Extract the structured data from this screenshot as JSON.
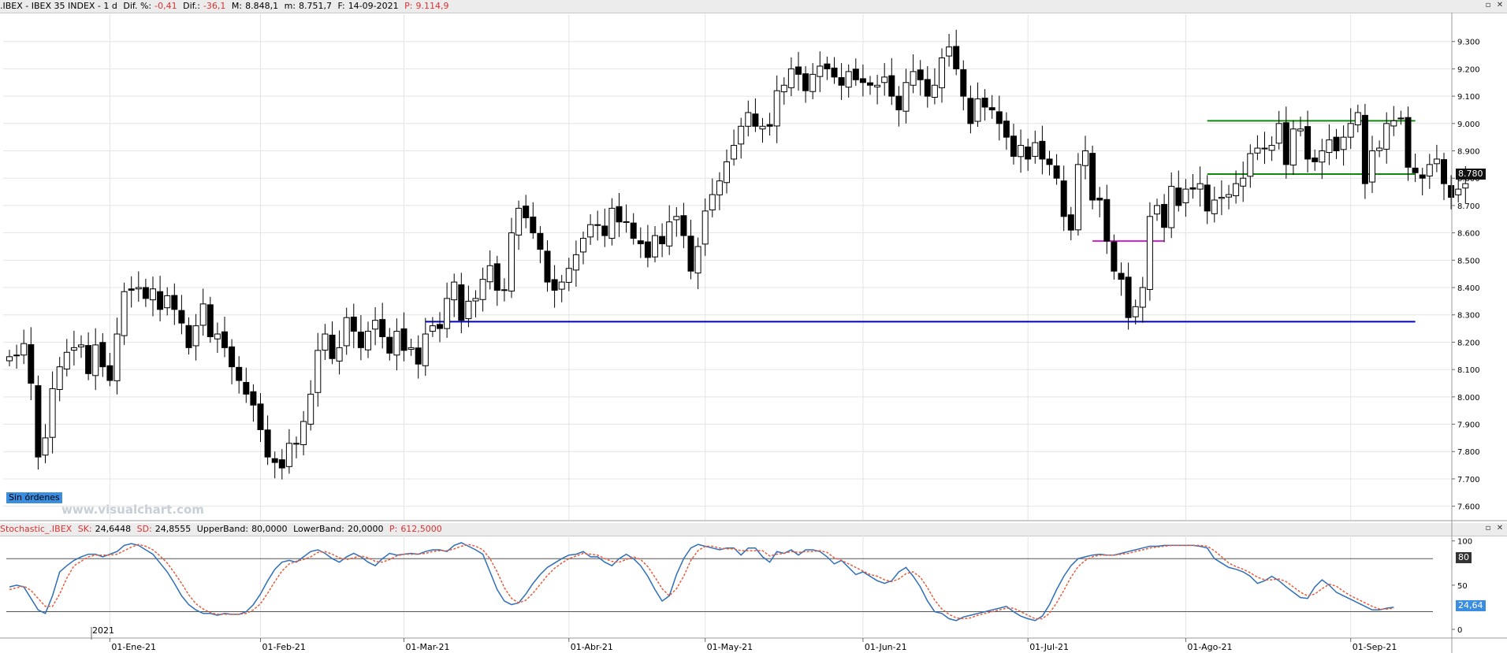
{
  "header": {
    "symbol": ".IBEX - IBEX 35 INDEX - 1 d",
    "dif_pct_label": "Dif. %:",
    "dif_pct": "-0,41",
    "dif_label": "Dif.:",
    "dif": "-36,1",
    "max_label": "M:",
    "max": "8.848,1",
    "min_label": "m:",
    "min": "8.751,7",
    "date_label": "F:",
    "date": "14-09-2021",
    "close_label": "P:",
    "close": "9.114,9"
  },
  "indicator_header": {
    "name": "Stochastic_.IBEX",
    "sk_label": "SK:",
    "sk": "24,6448",
    "sd_label": "SD:",
    "sd": "24,8555",
    "upper_label": "UpperBand:",
    "upper": "80,0000",
    "lower_label": "LowerBand:",
    "lower": "20,0000",
    "p_label": "P:",
    "p": "612,5000"
  },
  "window_controls": {
    "restore": "▫",
    "close": "✕"
  },
  "watermark": "www.visualchart.com",
  "orders_badge": "Sin órdenes",
  "price_badge": "8.780",
  "stoch_badges": {
    "upper": "80",
    "current": "24,64"
  },
  "year_label": "2021",
  "colors": {
    "sk_line": "#2f6fb8",
    "sd_line": "#e85d3a",
    "support": "#0000cc",
    "range": "#118811",
    "gap": "#dd22dd",
    "badge_bg": "#3b8de0",
    "grid": "#e4e4e4"
  },
  "chart_data": [
    {
      "type": "candlestick",
      "ylim": [
        7550,
        9400
      ],
      "yticks": [
        7600,
        7700,
        7800,
        7900,
        8000,
        8100,
        8200,
        8300,
        8400,
        8500,
        8600,
        8700,
        8800,
        8900,
        9000,
        9100,
        9200,
        9300
      ],
      "ytick_labels": [
        "7.600",
        "7.700",
        "7.800",
        "7.900",
        "8.000",
        "8.100",
        "8.200",
        "8.300",
        "8.400",
        "8.500",
        "8.600",
        "8.700",
        "8.800",
        "8.900",
        "9.000",
        "9.100",
        "9.200",
        "9.300"
      ],
      "xtick_labels": [
        "01-Ene-21",
        "01-Feb-21",
        "01-Mar-21",
        "01-Abr-21",
        "01-May-21",
        "01-Jun-21",
        "01-Jul-21",
        "01-Ago-21",
        "01-Sep-21"
      ],
      "xtick_bar_index": [
        14,
        35,
        55,
        78,
        97,
        119,
        142,
        164,
        187
      ],
      "grid": true,
      "horizontal_lines": [
        {
          "name": "support",
          "value": 8275,
          "from_bar": 58,
          "to_bar": 196
        },
        {
          "name": "range-top",
          "value": 9010,
          "from_bar": 167,
          "to_bar": 196
        },
        {
          "name": "range-bottom",
          "value": 8815,
          "from_bar": 167,
          "to_bar": 196
        },
        {
          "name": "gap",
          "value": 8570,
          "from_bar": 151,
          "to_bar": 161
        }
      ],
      "closes": [
        8147,
        8152,
        8195,
        8050,
        7780,
        7850,
        8030,
        8110,
        8163,
        8180,
        8190,
        8085,
        8190,
        8110,
        8060,
        8230,
        8385,
        8390,
        8400,
        8360,
        8395,
        8320,
        8370,
        8320,
        8270,
        8180,
        8260,
        8340,
        8220,
        8230,
        8180,
        8110,
        8060,
        8010,
        7970,
        7880,
        7780,
        7760,
        7740,
        7830,
        7830,
        7910,
        8010,
        8170,
        8230,
        8140,
        8180,
        8290,
        8240,
        8180,
        8240,
        8280,
        8220,
        8160,
        8240,
        8170,
        8180,
        8120,
        8230,
        8260,
        8250,
        8360,
        8420,
        8280,
        8350,
        8360,
        8430,
        8480,
        8390,
        8390,
        8600,
        8690,
        8655,
        8600,
        8540,
        8420,
        8390,
        8420,
        8470,
        8520,
        8580,
        8630,
        8630,
        8590,
        8690,
        8640,
        8640,
        8580,
        8560,
        8510,
        8590,
        8560,
        8640,
        8660,
        8590,
        8460,
        8550,
        8680,
        8740,
        8790,
        8860,
        8920,
        8990,
        9040,
        8990,
        8990,
        8990,
        9120,
        9140,
        9200,
        9180,
        9120,
        9180,
        9210,
        9200,
        9170,
        9140,
        9190,
        9160,
        9150,
        9140,
        9140,
        9170,
        9100,
        9050,
        9150,
        9190,
        9160,
        9100,
        9140,
        9240,
        9280,
        9200,
        9100,
        9000,
        9090,
        9060,
        9050,
        9000,
        8950,
        8880,
        8920,
        8870,
        8930,
        8870,
        8850,
        8800,
        8660,
        8610,
        8850,
        8900,
        8720,
        8720,
        8570,
        8460,
        8430,
        8290,
        8330,
        8400,
        8660,
        8700,
        8620,
        8770,
        8700,
        8760,
        8760,
        8780,
        8680,
        8720,
        8730,
        8740,
        8780,
        8800,
        8890,
        8910,
        8910,
        8920,
        9000,
        8850,
        8980,
        8980,
        8870,
        8860,
        8900,
        8940,
        8900,
        8950,
        9000,
        9040,
        8780,
        8900,
        8910,
        9000,
        9010,
        9020,
        8840,
        8820,
        8800,
        8850,
        8870,
        8780,
        8730,
        8760,
        8780
      ]
    },
    {
      "type": "line",
      "title": "Stochastic_.IBEX",
      "ylim": [
        -8,
        106
      ],
      "yticks": [
        0,
        50,
        100
      ],
      "ytick_labels": [
        "0",
        "50",
        "100"
      ],
      "bands": [
        80,
        20
      ],
      "series": [
        {
          "name": "SK",
          "values": [
            48,
            50,
            48,
            35,
            22,
            18,
            38,
            65,
            72,
            78,
            82,
            85,
            85,
            82,
            85,
            88,
            95,
            97,
            95,
            90,
            85,
            75,
            65,
            52,
            38,
            28,
            22,
            18,
            18,
            16,
            18,
            17,
            17,
            20,
            28,
            40,
            55,
            68,
            76,
            78,
            76,
            82,
            88,
            90,
            86,
            80,
            76,
            82,
            86,
            82,
            76,
            72,
            80,
            86,
            84,
            85,
            86,
            85,
            88,
            90,
            90,
            88,
            95,
            98,
            94,
            90,
            85,
            65,
            45,
            32,
            28,
            30,
            40,
            52,
            62,
            70,
            75,
            80,
            84,
            85,
            88,
            82,
            82,
            76,
            72,
            80,
            85,
            80,
            72,
            60,
            45,
            32,
            38,
            62,
            80,
            92,
            96,
            94,
            92,
            90,
            92,
            92,
            84,
            92,
            92,
            82,
            76,
            88,
            86,
            90,
            84,
            90,
            90,
            88,
            82,
            74,
            78,
            70,
            62,
            65,
            60,
            55,
            52,
            55,
            65,
            70,
            60,
            48,
            32,
            20,
            18,
            12,
            10,
            14,
            16,
            18,
            20,
            22,
            24,
            26,
            20,
            15,
            12,
            10,
            15,
            28,
            45,
            60,
            72,
            80,
            82,
            84,
            85,
            84,
            84,
            86,
            88,
            90,
            92,
            94,
            94,
            95,
            95,
            95,
            95,
            95,
            94,
            92,
            80,
            75,
            70,
            68,
            65,
            60,
            52,
            55,
            60,
            55,
            48,
            42,
            36,
            35,
            48,
            56,
            50,
            42,
            38,
            34,
            30,
            26,
            22,
            22,
            24,
            25
          ]
        },
        {
          "name": "SD",
          "values": [
            45,
            47,
            49,
            44,
            35,
            26,
            26,
            40,
            58,
            72,
            77,
            82,
            84,
            84,
            84,
            85,
            89,
            93,
            96,
            94,
            90,
            83,
            75,
            64,
            52,
            39,
            29,
            23,
            19,
            17,
            17,
            17,
            17,
            18,
            22,
            29,
            41,
            54,
            66,
            74,
            77,
            79,
            82,
            87,
            88,
            85,
            81,
            79,
            81,
            83,
            81,
            77,
            76,
            79,
            83,
            85,
            85,
            85,
            86,
            88,
            89,
            89,
            91,
            94,
            96,
            94,
            90,
            80,
            65,
            47,
            35,
            30,
            33,
            41,
            51,
            61,
            69,
            75,
            80,
            83,
            86,
            85,
            84,
            80,
            77,
            76,
            79,
            82,
            79,
            71,
            59,
            46,
            38,
            46,
            60,
            78,
            89,
            94,
            94,
            92,
            91,
            91,
            89,
            89,
            89,
            89,
            83,
            85,
            86,
            88,
            87,
            88,
            88,
            89,
            87,
            81,
            78,
            74,
            70,
            66,
            62,
            60,
            56,
            54,
            57,
            63,
            65,
            59,
            47,
            33,
            23,
            17,
            13,
            12,
            13,
            16,
            18,
            20,
            22,
            24,
            24,
            20,
            16,
            12,
            12,
            18,
            30,
            44,
            59,
            71,
            78,
            82,
            84,
            84,
            84,
            85,
            86,
            88,
            90,
            92,
            93,
            94,
            95,
            95,
            95,
            95,
            95,
            94,
            89,
            82,
            75,
            71,
            68,
            64,
            59,
            56,
            56,
            57,
            54,
            48,
            42,
            38,
            40,
            46,
            51,
            49,
            43,
            38,
            34,
            30,
            26,
            23,
            23,
            24
          ]
        }
      ]
    }
  ]
}
